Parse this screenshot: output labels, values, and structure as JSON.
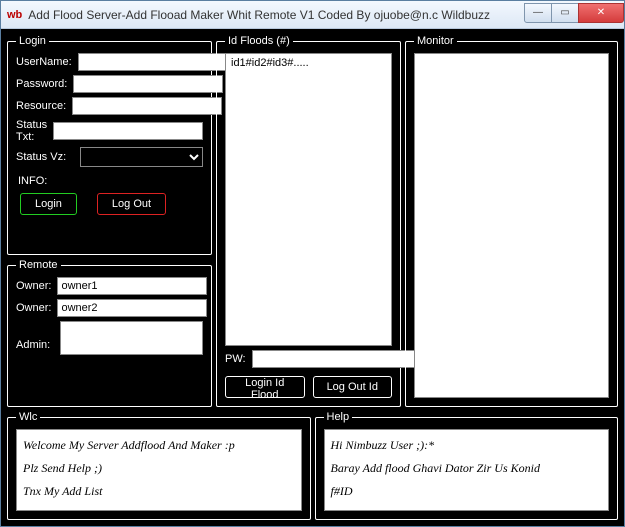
{
  "window": {
    "title": "Add Flood Server-Add Flooad Maker Whit Remote V1 Coded By ojuobe@n.c Wildbuzz",
    "icon_text": "wb"
  },
  "login": {
    "legend": "Login",
    "username_label": "UserName:",
    "password_label": "Password:",
    "resource_label": "Resource:",
    "statustxt_label": "Status Txt:",
    "statusvz_label": "Status Vz:",
    "info_label": "INFO:",
    "login_btn": "Login",
    "logout_btn": "Log Out",
    "username_value": "",
    "password_value": "",
    "resource_value": "",
    "statustxt_value": "",
    "statusvz_value": ""
  },
  "remote": {
    "legend": "Remote",
    "owner1_label": "Owner:",
    "owner1_value": "owner1",
    "owner2_label": "Owner:",
    "owner2_value": "owner2",
    "admin_label": "Admin:"
  },
  "idfloods": {
    "legend": "Id Floods (#)",
    "list_text": "id1#id2#id3#.....",
    "pw_label": "PW:",
    "pw_value": "",
    "login_btn": "Login Id Flood",
    "logout_btn": "Log Out Id"
  },
  "monitor": {
    "legend": "Monitor"
  },
  "wlc": {
    "legend": "Wlc",
    "line1": "Welcome My Server Addflood And Maker :p",
    "line2": "Plz Send Help ;)",
    "line3": "Tnx My Add List"
  },
  "help": {
    "legend": "Help",
    "line1": "Hi Nimbuzz User ;):*",
    "line2": "Baray Add flood Ghavi Dator Zir Us Konid",
    "line3": "f#ID"
  }
}
